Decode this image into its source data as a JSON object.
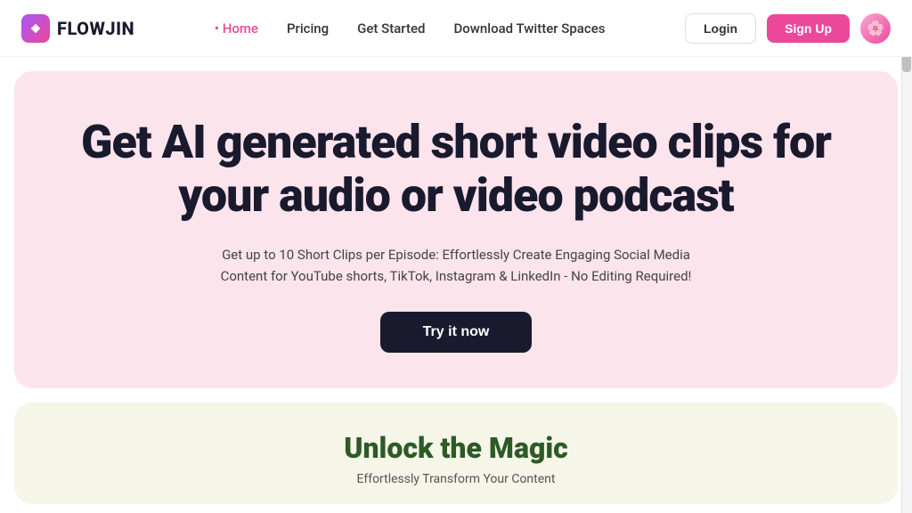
{
  "logo": {
    "text": "FLOWJIN"
  },
  "nav": {
    "links": [
      {
        "id": "home",
        "label": "Home",
        "active": true
      },
      {
        "id": "pricing",
        "label": "Pricing",
        "active": false
      },
      {
        "id": "get-started",
        "label": "Get Started",
        "active": false
      },
      {
        "id": "download-twitter-spaces",
        "label": "Download Twitter Spaces",
        "active": false
      }
    ],
    "login_label": "Login",
    "signup_label": "Sign Up"
  },
  "hero": {
    "title": "Get AI generated short video clips for your audio or video podcast",
    "subtitle": "Get up to 10 Short Clips per Episode: Effortlessly Create Engaging Social Media Content for YouTube shorts, TikTok, Instagram & LinkedIn - No Editing Required!",
    "cta_label": "Try it now"
  },
  "unlock": {
    "title": "Unlock the Magic",
    "subtitle": "Effortlessly Transform Your Content"
  },
  "colors": {
    "accent": "#ec4899",
    "dark": "#1a1a2e",
    "hero_bg": "#fce4ec",
    "unlock_bg": "#f5f5e8",
    "unlock_title": "#2d5a27"
  }
}
